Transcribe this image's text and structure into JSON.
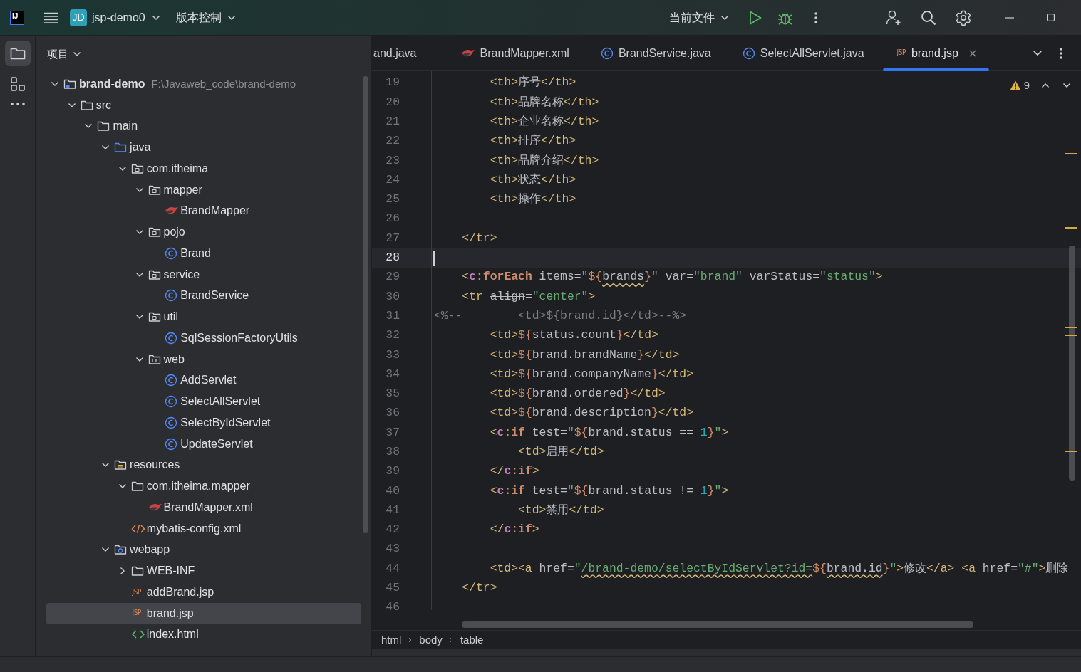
{
  "title_bar": {
    "logo": "IJ",
    "project_badge": "JD",
    "project": "jsp-demo0",
    "vcs": "版本控制",
    "run_config": "当前文件"
  },
  "project_panel": {
    "title": "项目",
    "tree": [
      {
        "kind": "module",
        "label": "brand-demo",
        "path": "F:\\Javaweb_code\\brand-demo",
        "selected": false,
        "expanded": true,
        "children": [
          {
            "kind": "folder",
            "label": "src",
            "selected": false,
            "expanded": true,
            "children": [
              {
                "kind": "folder",
                "label": "main",
                "selected": false,
                "expanded": true,
                "children": [
                  {
                    "kind": "source",
                    "label": "java",
                    "selected": false,
                    "expanded": true,
                    "children": [
                      {
                        "kind": "package",
                        "label": "com.itheima",
                        "selected": false,
                        "expanded": true,
                        "children": [
                          {
                            "kind": "package",
                            "label": "mapper",
                            "selected": false,
                            "expanded": true,
                            "children": [
                              {
                                "kind": "mapper",
                                "label": "BrandMapper",
                                "selected": false
                              }
                            ]
                          },
                          {
                            "kind": "package",
                            "label": "pojo",
                            "selected": false,
                            "expanded": true,
                            "children": [
                              {
                                "kind": "class",
                                "label": "Brand",
                                "selected": false
                              }
                            ]
                          },
                          {
                            "kind": "package",
                            "label": "service",
                            "selected": false,
                            "expanded": true,
                            "children": [
                              {
                                "kind": "class",
                                "label": "BrandService",
                                "selected": false
                              }
                            ]
                          },
                          {
                            "kind": "package",
                            "label": "util",
                            "selected": false,
                            "expanded": true,
                            "children": [
                              {
                                "kind": "class",
                                "label": "SqlSessionFactoryUtils",
                                "selected": false
                              }
                            ]
                          },
                          {
                            "kind": "package",
                            "label": "web",
                            "selected": false,
                            "expanded": true,
                            "children": [
                              {
                                "kind": "class",
                                "label": "AddServlet",
                                "selected": false
                              },
                              {
                                "kind": "class",
                                "label": "SelectAllServlet",
                                "selected": false
                              },
                              {
                                "kind": "class",
                                "label": "SelectByIdServlet",
                                "selected": false
                              },
                              {
                                "kind": "class",
                                "label": "UpdateServlet",
                                "selected": false
                              }
                            ]
                          }
                        ]
                      }
                    ]
                  },
                  {
                    "kind": "resources",
                    "label": "resources",
                    "selected": false,
                    "expanded": true,
                    "children": [
                      {
                        "kind": "folder",
                        "label": "com.itheima.mapper",
                        "selected": false,
                        "expanded": true,
                        "children": [
                          {
                            "kind": "mapper",
                            "label": "BrandMapper.xml",
                            "selected": false
                          }
                        ]
                      },
                      {
                        "kind": "xml",
                        "label": "mybatis-config.xml",
                        "selected": false
                      }
                    ]
                  },
                  {
                    "kind": "web",
                    "label": "webapp",
                    "selected": false,
                    "expanded": true,
                    "children": [
                      {
                        "kind": "folder",
                        "label": "WEB-INF",
                        "selected": false,
                        "expanded": false
                      },
                      {
                        "kind": "jsp",
                        "badge": "JSP",
                        "label": "addBrand.jsp",
                        "selected": false
                      },
                      {
                        "kind": "jsp",
                        "badge": "JSP",
                        "label": "brand.jsp",
                        "selected": true
                      },
                      {
                        "kind": "html",
                        "label": "index.html",
                        "selected": false
                      }
                    ]
                  }
                ]
              }
            ]
          }
        ]
      }
    ]
  },
  "editor_tabs": [
    {
      "kind": "plain",
      "label": "and.java",
      "selected": false,
      "closable": false
    },
    {
      "kind": "mapper",
      "label": "BrandMapper.xml",
      "selected": false,
      "closable": false
    },
    {
      "kind": "class",
      "label": "BrandService.java",
      "selected": false,
      "closable": false
    },
    {
      "kind": "class",
      "label": "SelectAllServlet.java",
      "selected": false,
      "closable": false
    },
    {
      "kind": "jsp",
      "badge": "JSP",
      "label": "brand.jsp",
      "selected": true,
      "closable": true
    }
  ],
  "inspections": {
    "warnings": "9"
  },
  "code_lines": [
    {
      "number": "19",
      "current": false,
      "tokens": [
        {
          "kind": "tag",
          "text": "        <th>"
        },
        {
          "kind": "text",
          "text": "序号"
        },
        {
          "kind": "tag",
          "text": "</th>"
        }
      ]
    },
    {
      "number": "20",
      "current": false,
      "tokens": [
        {
          "kind": "tag",
          "text": "        <th>"
        },
        {
          "kind": "text",
          "text": "品牌名称"
        },
        {
          "kind": "tag",
          "text": "</th>"
        }
      ]
    },
    {
      "number": "21",
      "current": false,
      "tokens": [
        {
          "kind": "tag",
          "text": "        <th>"
        },
        {
          "kind": "text",
          "text": "企业名称"
        },
        {
          "kind": "tag",
          "text": "</th>"
        }
      ]
    },
    {
      "number": "22",
      "current": false,
      "tokens": [
        {
          "kind": "tag",
          "text": "        <th>"
        },
        {
          "kind": "text",
          "text": "排序"
        },
        {
          "kind": "tag",
          "text": "</th>"
        }
      ]
    },
    {
      "number": "23",
      "current": false,
      "tokens": [
        {
          "kind": "tag",
          "text": "        <th>"
        },
        {
          "kind": "text",
          "text": "品牌介绍"
        },
        {
          "kind": "tag",
          "text": "</th>"
        }
      ]
    },
    {
      "number": "24",
      "current": false,
      "tokens": [
        {
          "kind": "tag",
          "text": "        <th>"
        },
        {
          "kind": "text",
          "text": "状态"
        },
        {
          "kind": "tag",
          "text": "</th>"
        }
      ]
    },
    {
      "number": "25",
      "current": false,
      "tokens": [
        {
          "kind": "tag",
          "text": "        <th>"
        },
        {
          "kind": "text",
          "text": "操作"
        },
        {
          "kind": "tag",
          "text": "</th>"
        }
      ]
    },
    {
      "number": "26",
      "current": false
    },
    {
      "number": "27",
      "current": false,
      "tokens": [
        {
          "kind": "tag",
          "text": "    </tr>"
        }
      ]
    },
    {
      "number": "28",
      "current": true
    },
    {
      "number": "29",
      "current": false,
      "tokens": [
        {
          "kind": "tag",
          "text": "    <"
        },
        {
          "kind": "ns",
          "text": "c"
        },
        {
          "kind": "jstl",
          "text": ":forEach"
        },
        {
          "kind": "text",
          "text": " items="
        },
        {
          "kind": "string",
          "text": "\""
        },
        {
          "kind": "el",
          "text": "${"
        },
        {
          "kind": "expr_warn",
          "text": "brands"
        },
        {
          "kind": "el",
          "text": "}"
        },
        {
          "kind": "string",
          "text": "\""
        },
        {
          "kind": "text",
          "text": " var="
        },
        {
          "kind": "string",
          "text": "\"brand\""
        },
        {
          "kind": "text",
          "text": " varStatus="
        },
        {
          "kind": "string",
          "text": "\"status\""
        },
        {
          "kind": "tag",
          "text": ">"
        }
      ]
    },
    {
      "number": "30",
      "current": false,
      "tokens": [
        {
          "kind": "tag",
          "text": "    <tr "
        },
        {
          "kind": "strike",
          "text": "align"
        },
        {
          "kind": "text",
          "text": "="
        },
        {
          "kind": "string",
          "text": "\"center\""
        },
        {
          "kind": "tag",
          "text": ">"
        }
      ]
    },
    {
      "number": "31",
      "current": false,
      "tokens": [
        {
          "kind": "comment",
          "text": "<%--        <td>${brand.id}</td>--%>"
        }
      ]
    },
    {
      "number": "32",
      "current": false,
      "tokens": [
        {
          "kind": "tag",
          "text": "        <td>"
        },
        {
          "kind": "el",
          "text": "${"
        },
        {
          "kind": "text",
          "text": "status.count"
        },
        {
          "kind": "el",
          "text": "}"
        },
        {
          "kind": "tag",
          "text": "</td>"
        }
      ]
    },
    {
      "number": "33",
      "current": false,
      "tokens": [
        {
          "kind": "tag",
          "text": "        <td>"
        },
        {
          "kind": "el",
          "text": "${"
        },
        {
          "kind": "text",
          "text": "brand.brandName"
        },
        {
          "kind": "el",
          "text": "}"
        },
        {
          "kind": "tag",
          "text": "</td>"
        }
      ]
    },
    {
      "number": "34",
      "current": false,
      "tokens": [
        {
          "kind": "tag",
          "text": "        <td>"
        },
        {
          "kind": "el",
          "text": "${"
        },
        {
          "kind": "text",
          "text": "brand.companyName"
        },
        {
          "kind": "el",
          "text": "}"
        },
        {
          "kind": "tag",
          "text": "</td>"
        }
      ]
    },
    {
      "number": "35",
      "current": false,
      "tokens": [
        {
          "kind": "tag",
          "text": "        <td>"
        },
        {
          "kind": "el",
          "text": "${"
        },
        {
          "kind": "text",
          "text": "brand.ordered"
        },
        {
          "kind": "el",
          "text": "}"
        },
        {
          "kind": "tag",
          "text": "</td>"
        }
      ]
    },
    {
      "number": "36",
      "current": false,
      "tokens": [
        {
          "kind": "tag",
          "text": "        <td>"
        },
        {
          "kind": "el",
          "text": "${"
        },
        {
          "kind": "text",
          "text": "brand.description"
        },
        {
          "kind": "el",
          "text": "}"
        },
        {
          "kind": "tag",
          "text": "</td>"
        }
      ]
    },
    {
      "number": "37",
      "current": false,
      "tokens": [
        {
          "kind": "tag",
          "text": "        <"
        },
        {
          "kind": "ns",
          "text": "c"
        },
        {
          "kind": "jstl",
          "text": ":if"
        },
        {
          "kind": "text",
          "text": " test="
        },
        {
          "kind": "string",
          "text": "\""
        },
        {
          "kind": "el",
          "text": "${"
        },
        {
          "kind": "text",
          "text": "brand.status == "
        },
        {
          "kind": "num",
          "text": "1"
        },
        {
          "kind": "el",
          "text": "}"
        },
        {
          "kind": "string",
          "text": "\""
        },
        {
          "kind": "tag",
          "text": ">"
        }
      ]
    },
    {
      "number": "38",
      "current": false,
      "tokens": [
        {
          "kind": "tag",
          "text": "            <td>"
        },
        {
          "kind": "text",
          "text": "启用"
        },
        {
          "kind": "tag",
          "text": "</td>"
        }
      ]
    },
    {
      "number": "39",
      "current": false,
      "tokens": [
        {
          "kind": "tag",
          "text": "        </"
        },
        {
          "kind": "ns",
          "text": "c"
        },
        {
          "kind": "jstl",
          "text": ":if"
        },
        {
          "kind": "tag",
          "text": ">"
        }
      ]
    },
    {
      "number": "40",
      "current": false,
      "tokens": [
        {
          "kind": "tag",
          "text": "        <"
        },
        {
          "kind": "ns",
          "text": "c"
        },
        {
          "kind": "jstl",
          "text": ":if"
        },
        {
          "kind": "text",
          "text": " test="
        },
        {
          "kind": "string",
          "text": "\""
        },
        {
          "kind": "el",
          "text": "${"
        },
        {
          "kind": "text",
          "text": "brand.status != "
        },
        {
          "kind": "num",
          "text": "1"
        },
        {
          "kind": "el",
          "text": "}"
        },
        {
          "kind": "string",
          "text": "\""
        },
        {
          "kind": "tag",
          "text": ">"
        }
      ]
    },
    {
      "number": "41",
      "current": false,
      "tokens": [
        {
          "kind": "tag",
          "text": "            <td>"
        },
        {
          "kind": "text",
          "text": "禁用"
        },
        {
          "kind": "tag",
          "text": "</td>"
        }
      ]
    },
    {
      "number": "42",
      "current": false,
      "tokens": [
        {
          "kind": "tag",
          "text": "        </"
        },
        {
          "kind": "ns",
          "text": "c"
        },
        {
          "kind": "jstl",
          "text": ":if"
        },
        {
          "kind": "tag",
          "text": ">"
        }
      ]
    },
    {
      "number": "43",
      "current": false
    },
    {
      "number": "44",
      "current": false,
      "tokens": [
        {
          "kind": "tag",
          "text": "        <td><a"
        },
        {
          "kind": "text",
          "text": " href="
        },
        {
          "kind": "string",
          "text": "\""
        },
        {
          "kind": "string_warn",
          "text": "/brand-demo/selectByIdServlet?id="
        },
        {
          "kind": "el",
          "text": "${"
        },
        {
          "kind": "expr_warn",
          "text": "brand.id"
        },
        {
          "kind": "el",
          "text": "}"
        },
        {
          "kind": "string",
          "text": "\""
        },
        {
          "kind": "tag",
          "text": ">"
        },
        {
          "kind": "text",
          "text": "修改"
        },
        {
          "kind": "tag",
          "text": "</a> <a"
        },
        {
          "kind": "text",
          "text": " href="
        },
        {
          "kind": "string",
          "text": "\"#\""
        },
        {
          "kind": "tag",
          "text": ">"
        },
        {
          "kind": "text",
          "text": "删除"
        }
      ]
    },
    {
      "number": "45",
      "current": false,
      "tokens": [
        {
          "kind": "tag",
          "text": "    </tr>"
        }
      ]
    },
    {
      "number": "46",
      "current": false
    }
  ],
  "breadcrumbs": [
    "html",
    "body",
    "table"
  ]
}
